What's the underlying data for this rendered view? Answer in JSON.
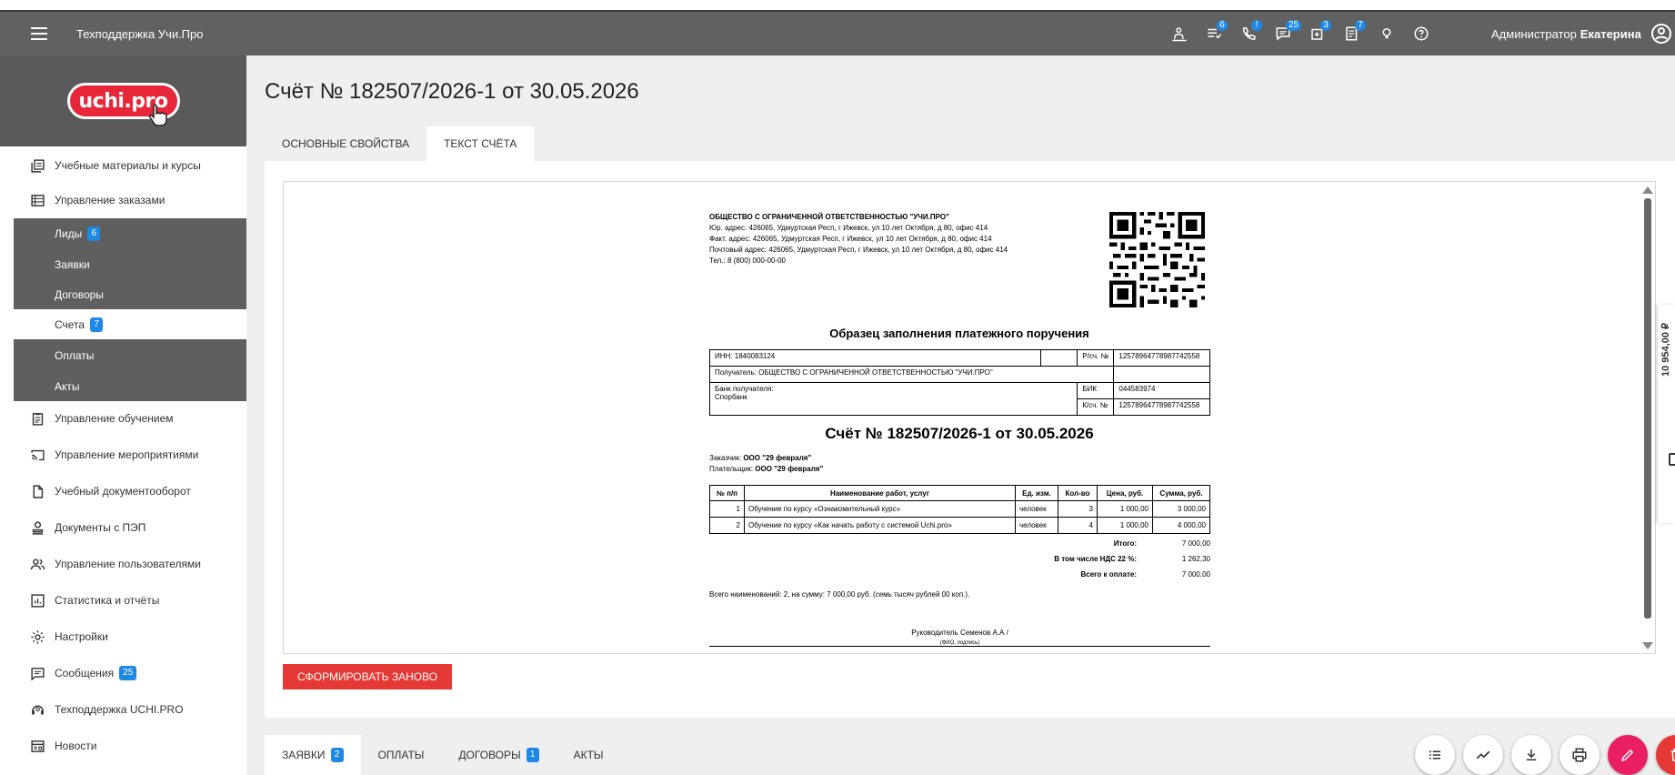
{
  "topbar": {
    "app_title": "Техподдержка Учи.Про",
    "badges": {
      "tasks": "6",
      "calls": "!",
      "messages": "25",
      "notes": "3",
      "docs": "7"
    },
    "user_role": "Администратор",
    "user_name": "Екатерина"
  },
  "sidebar": {
    "logo_text": "uchi.pro",
    "items": [
      {
        "label": "Учебные материалы и курсы"
      },
      {
        "label": "Управление заказами"
      },
      {
        "label": "Управление обучением"
      },
      {
        "label": "Управление мероприятиями"
      },
      {
        "label": "Учебный документооборот"
      },
      {
        "label": "Документы с ПЭП"
      },
      {
        "label": "Управление пользователями"
      },
      {
        "label": "Статистика и отчёты"
      },
      {
        "label": "Настройки"
      },
      {
        "label": "Сообщения",
        "badge": "25"
      },
      {
        "label": "Техподдержка UCHI.PRO"
      },
      {
        "label": "Новости"
      }
    ],
    "sub_items": [
      {
        "label": "Лиды",
        "badge": "6"
      },
      {
        "label": "Заявки"
      },
      {
        "label": "Договоры"
      },
      {
        "label": "Счета",
        "badge": "7"
      },
      {
        "label": "Оплаты"
      },
      {
        "label": "Акты"
      }
    ]
  },
  "main": {
    "title": "Счёт № 182507/2026-1 от 30.05.2026",
    "tabs": [
      {
        "label": "Основные свойства"
      },
      {
        "label": "Текст счёта"
      }
    ],
    "side_amount": "10 954,00 ₽",
    "regen_button": "Сформировать заново"
  },
  "document": {
    "org_name": "ОБЩЕСТВО С ОГРАНИЧЕННОЙ ОТВЕТСТВЕННОСТЬЮ \"УЧИ.ПРО\"",
    "legal_address": "Юр. адрес: 426065, Удмуртская Респ, г Ижевск, ул 10 лет Октября, д 80, офис 414",
    "actual_address": "Факт. адрес: 426065, Удмуртская Респ, г Ижевск, ул 10 лет Октября, д 80, офис 414",
    "postal_address": "Почтовый адрес: 426065, Удмуртская Респ, г Ижевск, ул 10 лет Октября, д 80, офис 414",
    "phone": "Тел.: 8 (800) 000-00-00",
    "payment_title": "Образец заполнения платежного поручения",
    "inn": "ИНН: 1840083124",
    "rs_label": "Р/сч. №",
    "rs_value": "12578964778987742558",
    "recipient": "Получатель: ОБЩЕСТВО С ОГРАНИЧЕННОЙ ОТВЕТСТВЕННОСТЬЮ \"УЧИ.ПРО\"",
    "bank_label": "Банк получателя:",
    "bank_name": "Спорбанк",
    "bik_label": "БИК",
    "bik_value": "044583974",
    "ks_label": "К/сч. №",
    "ks_value": "12578964778987742558",
    "invoice_title": "Счёт № 182507/2026-1 от 30.05.2026",
    "customer_label": "Заказчик:",
    "customer": "ООО \"29 февраля\"",
    "payer_label": "Плательщик:",
    "payer": "ООО \"29 февраля\"",
    "items_headers": [
      "№ п/п",
      "Наименование работ, услуг",
      "Ед. изм.",
      "Кол-во",
      "Цена, руб.",
      "Сумма, руб."
    ],
    "items": [
      {
        "n": "1",
        "name": "Обучение по курсу «Ознакомительный курс»",
        "unit": "человек",
        "qty": "3",
        "price": "1 000,00",
        "sum": "3 000,00"
      },
      {
        "n": "2",
        "name": "Обучение по курсу «Как начать работу с системой Uchi.pro»",
        "unit": "человек",
        "qty": "4",
        "price": "1 000,00",
        "sum": "4 000,00"
      }
    ],
    "total_label": "Итого:",
    "total_value": "7 000,00",
    "vat_label": "В том числе НДС 22 %:",
    "vat_value": "1 262,30",
    "due_label": "Всего к оплате:",
    "due_value": "7 000,00",
    "total_words": "Всего наименований: 2, на сумму: 7 000,00 руб. (семь тысяч рублей 00 коп.).",
    "signer": "Руководитель Семенов А.А /",
    "signer_sub": "(ФИО, подпись)"
  },
  "bottom": {
    "tabs": [
      {
        "label": "Заявки",
        "badge": "2"
      },
      {
        "label": "Оплаты"
      },
      {
        "label": "Договоры",
        "badge": "1"
      },
      {
        "label": "Акты"
      }
    ]
  },
  "colors": {
    "topbar": "#616161",
    "accent_red": "#e53935",
    "badge_blue": "#1e88e5",
    "fab_pink": "#e91e63"
  },
  "icons": [
    "menu-icon",
    "user-plus-icon",
    "list-icon",
    "phone-icon",
    "chat-icon",
    "notes-icon",
    "doc-icon",
    "lightbulb-icon",
    "help-icon",
    "account-icon"
  ]
}
